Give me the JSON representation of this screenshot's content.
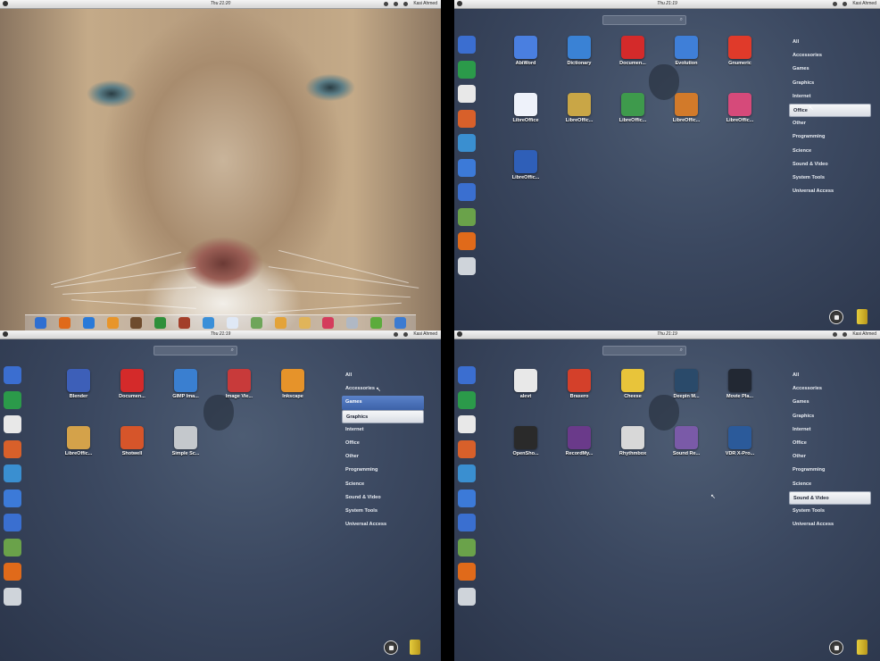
{
  "panel_a": {
    "clock": "Thu 21:20",
    "user": "Kasi Ahmed",
    "dock": [
      "#2f6fd1",
      "#e06a1a",
      "#2a7ad8",
      "#e8952a",
      "#6e4b2d",
      "#2f8f3a",
      "#a33f2a",
      "#3a8fd8",
      "#dfe8f5",
      "#6fa55a",
      "#e3a33a",
      "#e0b45a",
      "#d43c5c",
      "#b0b8c4",
      "#5cab3c",
      "#3c7bd1"
    ]
  },
  "panel_b": {
    "clock": "Thu 21:19",
    "user": "Kasi Ahmed",
    "apps": [
      {
        "label": "AbiWord",
        "color": "#4a7fe0"
      },
      {
        "label": "Dictionary",
        "color": "#3a82d5"
      },
      {
        "label": "Documen...",
        "color": "#d42a2a"
      },
      {
        "label": "Evolution",
        "color": "#3f7fd8"
      },
      {
        "label": "Gnumeric",
        "color": "#e03a2a"
      },
      {
        "label": "LibreOffice",
        "color": "#eef2fa"
      },
      {
        "label": "LibreOffic...",
        "color": "#c9a646"
      },
      {
        "label": "LibreOffic...",
        "color": "#3e9a4c"
      },
      {
        "label": "LibreOffic...",
        "color": "#d27a2a"
      },
      {
        "label": "LibreOffic...",
        "color": "#d64a7a"
      },
      {
        "label": "LibreOffic...",
        "color": "#2f5fb8"
      }
    ],
    "categories": [
      "All",
      "Accessories",
      "Games",
      "Graphics",
      "Internet",
      "Office",
      "Other",
      "Programming",
      "Science",
      "Sound & Video",
      "System Tools",
      "Universal Access"
    ],
    "selected": "Office"
  },
  "panel_c": {
    "clock": "Thu 21:19",
    "user": "Kasi Ahmed",
    "apps": [
      {
        "label": "Blender",
        "color": "#3d5fb8"
      },
      {
        "label": "Documen...",
        "color": "#d42a2a"
      },
      {
        "label": "GIMP Ima...",
        "color": "#3a7fd0"
      },
      {
        "label": "Image Vie...",
        "color": "#c83a3a"
      },
      {
        "label": "Inkscape",
        "color": "#e6932a"
      },
      {
        "label": "LibreOffic...",
        "color": "#d4a24a"
      },
      {
        "label": "Shotwell",
        "color": "#d6552a"
      },
      {
        "label": "Simple Sc...",
        "color": "#c4c8cc"
      }
    ],
    "categories": [
      "All",
      "Accessories",
      "Games",
      "Graphics",
      "Internet",
      "Office",
      "Other",
      "Programming",
      "Science",
      "Sound & Video",
      "System Tools",
      "Universal Access"
    ],
    "hover": "Games",
    "selected": "Graphics"
  },
  "panel_d": {
    "clock": "Thu 21:19",
    "user": "Kasi Ahmed",
    "apps": [
      {
        "label": "alevt",
        "color": "#e8e8e8"
      },
      {
        "label": "Brasero",
        "color": "#d4402a"
      },
      {
        "label": "Cheese",
        "color": "#e8c43a"
      },
      {
        "label": "Deepin M...",
        "color": "#2a4a6a"
      },
      {
        "label": "Movie Pla...",
        "color": "#222833"
      },
      {
        "label": "OpenSho...",
        "color": "#2a2a2a"
      },
      {
        "label": "RecordMy...",
        "color": "#6a3a8a"
      },
      {
        "label": "Rhythmbox",
        "color": "#d8d8d8"
      },
      {
        "label": "Sound Re...",
        "color": "#7a5aa8"
      },
      {
        "label": "VDR X-Pro...",
        "color": "#2b5a9a"
      }
    ],
    "categories": [
      "All",
      "Accessories",
      "Games",
      "Graphics",
      "Internet",
      "Office",
      "Other",
      "Programming",
      "Science",
      "Sound & Video",
      "System Tools",
      "Universal Access"
    ],
    "selected": "Sound & Video"
  },
  "side_icons": [
    "#3b6ed0",
    "#2b9a4a",
    "#e8e8e8",
    "#d8602a",
    "#3a8fd0",
    "#3c7ad8",
    "#3a6fd0",
    "#6aa24a",
    "#e06a1a",
    "#cfd4da"
  ]
}
